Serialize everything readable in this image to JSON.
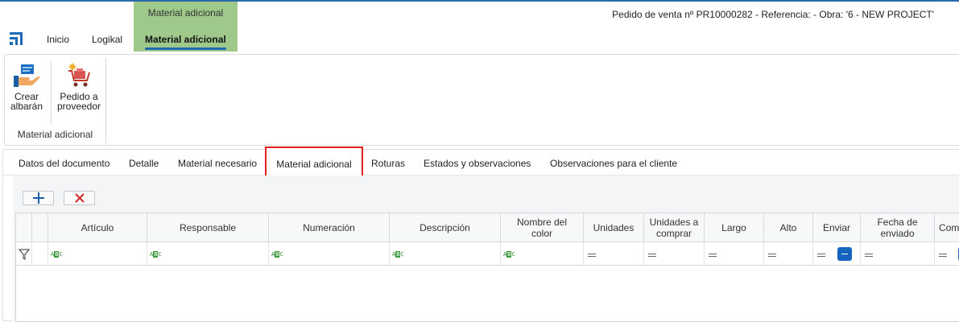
{
  "header": {
    "context_group_label": "Material adicional",
    "tabs": [
      {
        "label": "Inicio"
      },
      {
        "label": "Logikal"
      },
      {
        "label": "Material adicional",
        "active": true
      }
    ],
    "document_info": "Pedido de venta nº PR10000282 - Referencia:  - Obra: '6 - NEW PROJECT'",
    "accent_color": "#1f6ab5",
    "context_color": "#9fc98a"
  },
  "ribbon": {
    "buttons": [
      {
        "line1": "Crear",
        "line2": "albarán",
        "icon": "create-delivery-note-icon"
      },
      {
        "line1": "Pedido a",
        "line2": "proveedor",
        "icon": "supplier-order-cart-icon"
      }
    ],
    "group_label": "Material adicional"
  },
  "document_tabs": [
    {
      "label": "Datos del documento"
    },
    {
      "label": "Detalle"
    },
    {
      "label": "Material necesario"
    },
    {
      "label": "Material adicional",
      "active": true,
      "highlight_color": "#e41e1e"
    },
    {
      "label": "Roturas"
    },
    {
      "label": "Estados y observaciones"
    },
    {
      "label": "Observaciones para el cliente"
    }
  ],
  "grid": {
    "toolbar": [
      {
        "icon": "add-icon",
        "symbol": "+"
      },
      {
        "icon": "delete-icon",
        "symbol": "✕"
      }
    ],
    "columns": [
      {
        "label": "Artículo",
        "filter": "text"
      },
      {
        "label": "Responsable",
        "filter": "text"
      },
      {
        "label": "Numeración",
        "filter": "text"
      },
      {
        "label": "Descripción",
        "filter": "text"
      },
      {
        "label": "Nombre del color",
        "filter": "text"
      },
      {
        "label": "Unidades",
        "filter": "equals"
      },
      {
        "label": "Unidades a comprar",
        "filter": "equals"
      },
      {
        "label": "Largo",
        "filter": "equals"
      },
      {
        "label": "Alto",
        "filter": "equals"
      },
      {
        "label": "Enviar",
        "filter": "equals-checkbox"
      },
      {
        "label": "Fecha de enviado",
        "filter": "equals"
      },
      {
        "label": "Comp",
        "filter": "equals-checkbox"
      }
    ],
    "rows": []
  }
}
